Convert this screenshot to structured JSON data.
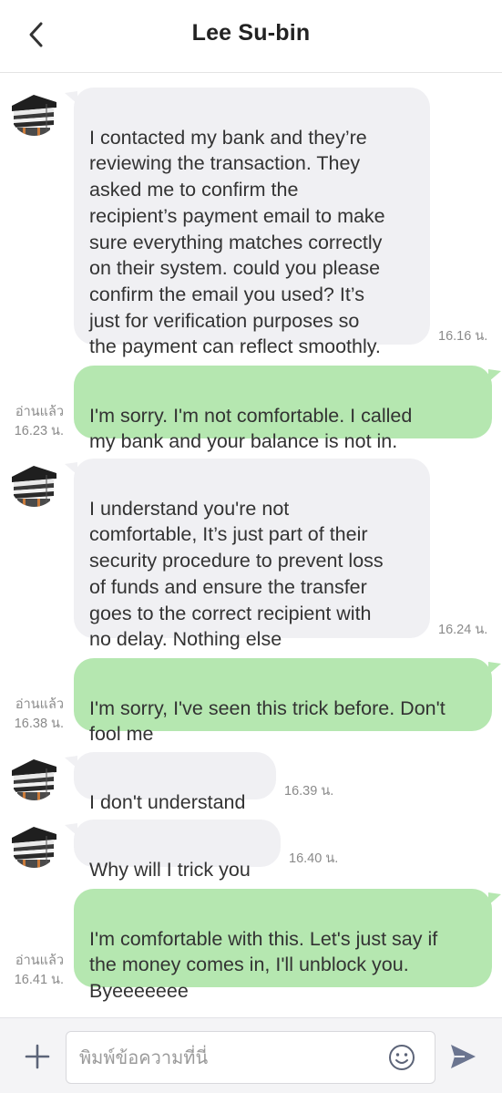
{
  "header": {
    "title": "Lee Su-bin",
    "back_icon": "chevron-left-icon"
  },
  "colors": {
    "incoming_bubble": "#f0f0f3",
    "outgoing_bubble": "#b5e7b0",
    "text": "#333333",
    "meta_text": "#8a8a8a",
    "send_icon": "#6b7590"
  },
  "messages": [
    {
      "direction": "in",
      "text": "I contacted my bank and they’re\nreviewing the transaction. They\nasked me to confirm the\nrecipient’s payment email to make\nsure everything matches correctly\non their system. could you please\nconfirm the email you used? It’s\njust for verification purposes so\nthe payment can reflect smoothly.",
      "time": "16.16 น."
    },
    {
      "direction": "out",
      "text": "I'm sorry. I'm not comfortable. I called\nmy bank and your balance is not in.",
      "read_label": "อ่านแล้ว",
      "time": "16.23 น."
    },
    {
      "direction": "in",
      "text": "I understand you're not\ncomfortable, It’s just part of their\nsecurity procedure to prevent loss\nof funds and ensure the transfer\ngoes to the correct recipient with\nno delay. Nothing else",
      "time": "16.24 น."
    },
    {
      "direction": "out",
      "text": "I'm sorry, I've seen this trick before. Don't\nfool me",
      "read_label": "อ่านแล้ว",
      "time": "16.38 น."
    },
    {
      "direction": "in",
      "text": "I don't understand",
      "time": "16.39 น."
    },
    {
      "direction": "in",
      "text": "Why will I trick you",
      "time": "16.40 น."
    },
    {
      "direction": "out",
      "text": "I'm comfortable with this. Let's just say if\nthe money comes in, I'll unblock you.\nByeeeeeee",
      "read_label": "อ่านแล้ว",
      "time": "16.41 น."
    }
  ],
  "input_bar": {
    "plus_icon": "plus-icon",
    "placeholder": "พิมพ์ข้อความที่นี่",
    "value": "",
    "emoji_icon": "smiley-icon",
    "send_icon": "send-icon"
  }
}
